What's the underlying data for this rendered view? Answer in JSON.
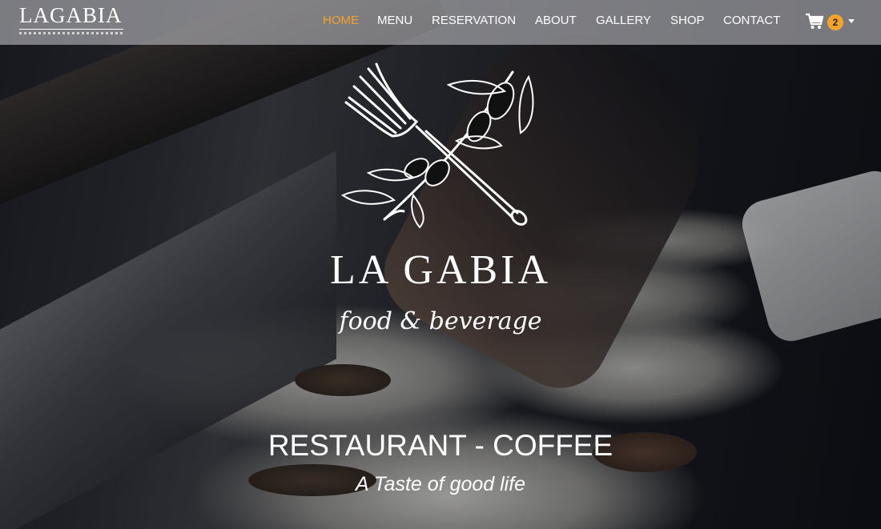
{
  "header": {
    "logo_text": "LAGABIA",
    "nav": [
      {
        "label": "HOME",
        "active": true
      },
      {
        "label": "MENU"
      },
      {
        "label": "RESERVATION"
      },
      {
        "label": "ABOUT"
      },
      {
        "label": "GALLERY"
      },
      {
        "label": "SHOP"
      },
      {
        "label": "CONTACT"
      }
    ],
    "cart": {
      "icon": "shopping-cart-icon",
      "count": "2"
    }
  },
  "hero": {
    "brand_name": "LA GABIA",
    "brand_subtitle": "food & beverage",
    "headline": "RESTAURANT - COFFEE",
    "tagline": "A Taste of good life"
  },
  "colors": {
    "accent": "#f4a32a",
    "header_bg": "rgba(185,185,190,0.62)",
    "text": "#ffffff"
  }
}
